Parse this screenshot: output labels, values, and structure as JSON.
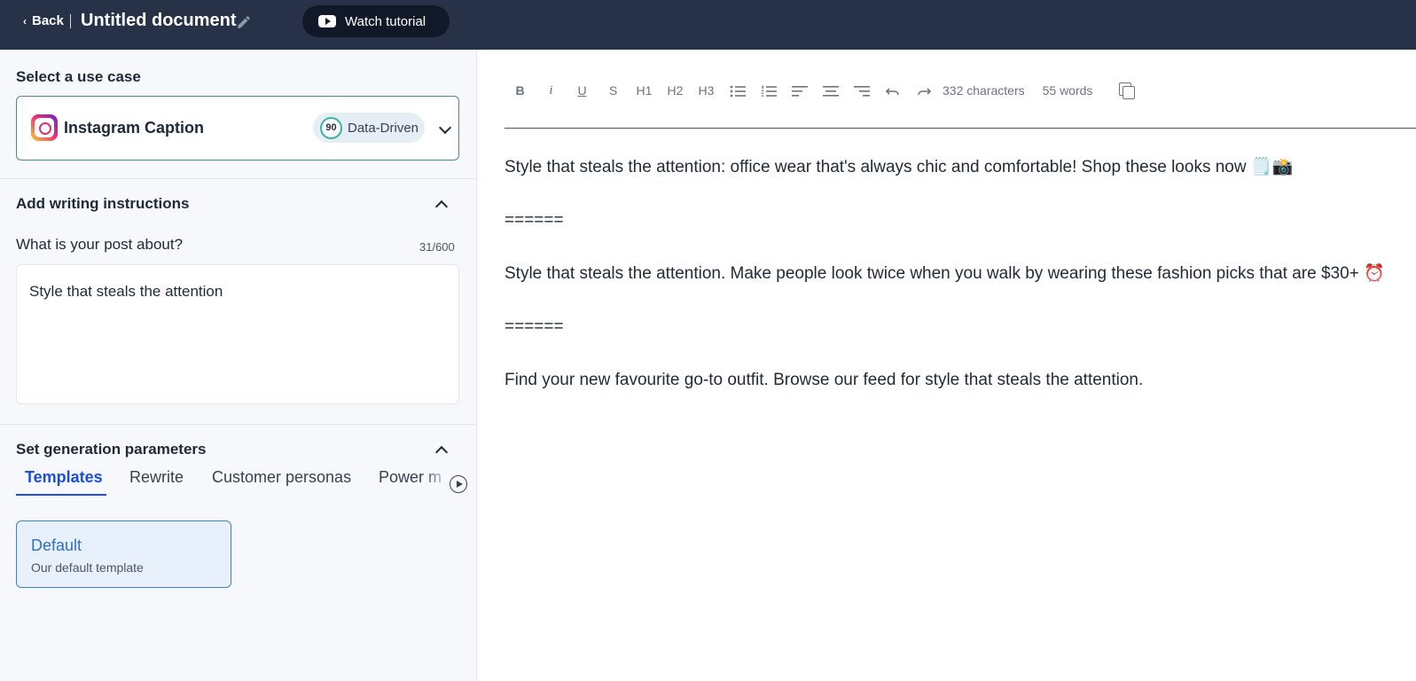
{
  "header": {
    "back_label": "Back",
    "doc_title": "Untitled document",
    "tutorial_label": "Watch tutorial"
  },
  "left_panel": {
    "use_case": {
      "section_title": "Select a use case",
      "selected": "Instagram Caption",
      "score": "90",
      "badge_label": "Data-Driven"
    },
    "instructions": {
      "section_title": "Add writing instructions",
      "field_label": "What is your post about?",
      "char_count": "31/600",
      "field_value": "Style that steals the attention"
    },
    "parameters": {
      "section_title": "Set generation parameters",
      "tabs": [
        "Templates",
        "Rewrite",
        "Customer personas",
        "Power m"
      ],
      "active_tab": "Templates",
      "templates": [
        {
          "name": "Default",
          "description": "Our default template"
        }
      ]
    }
  },
  "editor": {
    "toolbar": {
      "bold": "B",
      "italic": "i",
      "underline": "U",
      "strike": "S",
      "h1": "H1",
      "h2": "H2",
      "h3": "H3",
      "characters": "332 characters",
      "words": "55 words"
    },
    "paragraphs": [
      "Style that steals the attention: office wear that's always chic and comfortable! Shop these looks now 🗒️📸",
      "======",
      "Style that steals the attention. Make people look twice when you walk by wearing these fashion picks that are $30+ ⏰",
      "======",
      "Find your new favourite go-to outfit. Browse our feed for style that steals the attention."
    ]
  },
  "colors": {
    "topbar": "#273248",
    "accent": "#1d4ed8",
    "panel_bg": "#f6f8fb"
  }
}
